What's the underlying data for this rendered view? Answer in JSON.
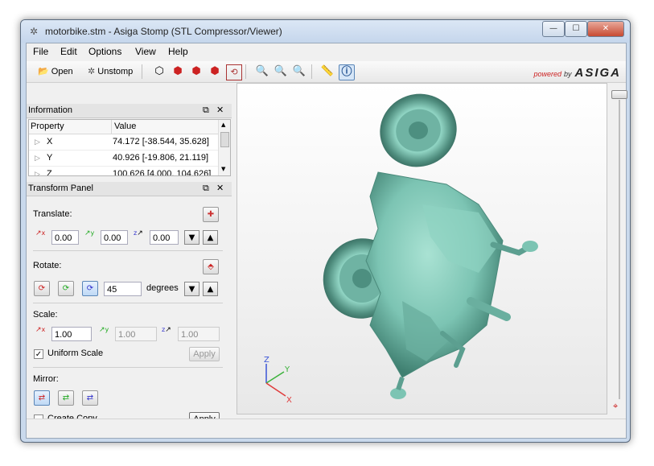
{
  "window": {
    "title": "motorbike.stm - Asiga Stomp (STL Compressor/Viewer)",
    "controls": {
      "minimize": "—",
      "maximize": "☐",
      "close": "✕"
    }
  },
  "menu": [
    "File",
    "Edit",
    "Options",
    "View",
    "Help"
  ],
  "toolbar": {
    "open_label": "Open",
    "unstomp_label": "Unstomp",
    "brand_powered": "powered",
    "brand_by": "by",
    "brand_name": "ASIGA"
  },
  "information": {
    "title": "Information",
    "columns": [
      "Property",
      "Value"
    ],
    "rows": [
      {
        "property": "X",
        "value": "74.172 [-38.544, 35.628]"
      },
      {
        "property": "Y",
        "value": "40.926 [-19.806, 21.119]"
      },
      {
        "property": "Z",
        "value": "100.626 [4.000, 104.626]"
      }
    ]
  },
  "transform": {
    "title": "Transform Panel",
    "translate": {
      "label": "Translate:",
      "x": "0.00",
      "y": "0.00",
      "z": "0.00"
    },
    "rotate": {
      "label": "Rotate:",
      "angle": "45",
      "unit": "degrees"
    },
    "scale": {
      "label": "Scale:",
      "x": "1.00",
      "y": "1.00",
      "z": "1.00",
      "uniform_label": "Uniform Scale",
      "uniform_checked": true,
      "apply": "Apply"
    },
    "mirror": {
      "label": "Mirror:",
      "create_copy_label": "Create Copy",
      "create_copy_checked": false,
      "apply": "Apply"
    }
  },
  "axes": {
    "x": "X",
    "y": "Y",
    "z": "Z"
  },
  "colors": {
    "model": "#7cc4b3",
    "axis_x": "#e03a3a",
    "axis_y": "#3bb23b",
    "axis_z": "#3a55d6",
    "brand_red": "#cc2222"
  }
}
